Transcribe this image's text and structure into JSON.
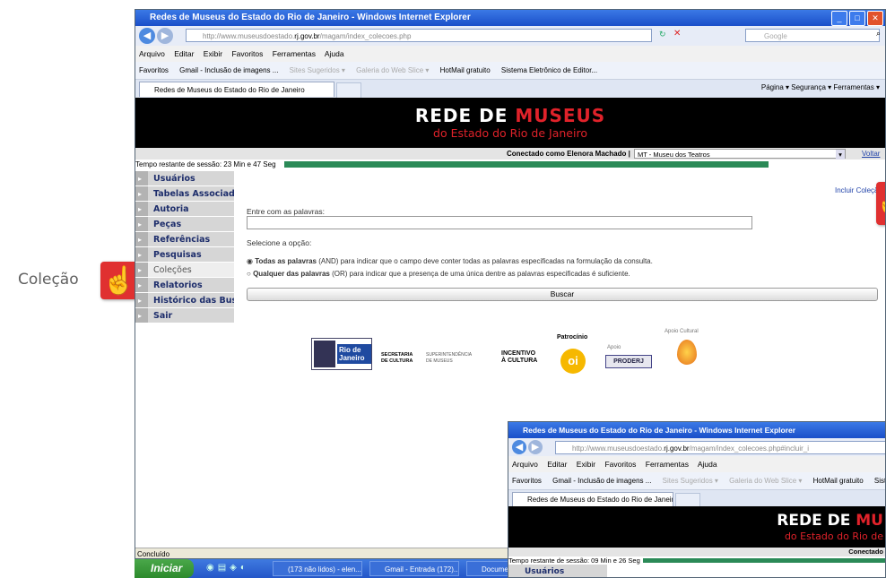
{
  "side_label": "Coleção",
  "window": {
    "title": "Redes de Museus do Estado do Rio de Janeiro - Windows Internet Explorer",
    "url_prefix": "http://www.museusdoestado.",
    "url_domain": "rj.gov.br",
    "url_suffix": "/magam/index_colecoes.php",
    "search_placeholder": "Google",
    "menu": [
      "Arquivo",
      "Editar",
      "Exibir",
      "Favoritos",
      "Ferramentas",
      "Ajuda"
    ],
    "favorites": [
      "Favoritos",
      "Gmail - Inclusão de imagens ...",
      "Sites Sugeridos ▾",
      "Galeria do Web Slice ▾",
      "HotMail gratuito",
      "Sistema Eletrônico de Editor..."
    ],
    "tab_title": "Redes de Museus do Estado do Rio de Janeiro",
    "command_bar": "Página ▾   Segurança ▾   Ferramentas ▾",
    "status": "Concluído"
  },
  "banner": {
    "line1_white": "REDE DE ",
    "line1_red": "MUSEUS",
    "line2": "do Estado do Rio de Janeiro"
  },
  "user_bar": {
    "connected": "Conectado como Elenora Machado |",
    "museum": "MT - Museu dos Teatros",
    "back": "Voltar"
  },
  "session": {
    "text": "Tempo restante de sessão: 23 Min e 47 Seg",
    "progress": 1.0
  },
  "sidebar": [
    {
      "label": "Usuários"
    },
    {
      "label": "Tabelas Associadas"
    },
    {
      "label": "Autoria"
    },
    {
      "label": "Peças"
    },
    {
      "label": "Referências"
    },
    {
      "label": "Pesquisas"
    },
    {
      "label": "Coleções"
    },
    {
      "label": "Relatorios"
    },
    {
      "label": "Histórico das Buscas"
    },
    {
      "label": "Sair"
    }
  ],
  "form": {
    "words_label": "Entre com as palavras:",
    "option_label": "Selecione a opção:",
    "opt_and_bold": "Todas as palavras",
    "opt_and_rest": " (AND) para indicar que o campo deve conter todas as palavras especificadas na formulação da consulta.",
    "opt_or_bold": "Qualquer das palavras",
    "opt_or_rest": " (OR) para indicar que a presença de uma única dentre as palavras especificadas é suficiente.",
    "search_button": "Buscar",
    "include_link": "Incluir Coleção"
  },
  "logos": {
    "rio": "Rio de Janeiro",
    "secretaria": "SECRETARIA DE CULTURA",
    "super": "SUPERINTENDÊNCIA DE MUSEUS",
    "incentivo": "INCENTIVO À CULTURA",
    "patrocinio": "Patrocínio",
    "apoio": "Apoio",
    "proderj": "PRODERJ",
    "apoio_cultural": "Apoio Cultural",
    "oi": "oi"
  },
  "taskbar": {
    "start": "Iniciar",
    "tasks": [
      "(173 não lidos) - elen...",
      "Gmail - Entrada (172)...",
      "Documen"
    ]
  },
  "inset": {
    "title": "Redes de Museus do Estado do Rio de Janeiro - Windows Internet Explorer",
    "url_prefix": "http://www.museusdoestado.",
    "url_domain": "rj.gov.br",
    "url_suffix": "/magam/index_colecoes.php#incluir_i",
    "menu": [
      "Arquivo",
      "Editar",
      "Exibir",
      "Favoritos",
      "Ferramentas",
      "Ajuda"
    ],
    "favorites": [
      "Favoritos",
      "Gmail - Inclusão de imagens ...",
      "Sites Sugeridos ▾",
      "Galeria do Web Slice ▾",
      "HotMail gratuito",
      "Siste"
    ],
    "tab_title": "Redes de Museus do Estado do Rio de Janeiro",
    "banner1_white": "REDE DE ",
    "banner1_red": "MU",
    "banner2": "do Estado do Rio de",
    "connected": "Conectado",
    "session": "Tempo restante de sessão: 09 Min e 26 Seg",
    "first_menu": "Usuários"
  }
}
